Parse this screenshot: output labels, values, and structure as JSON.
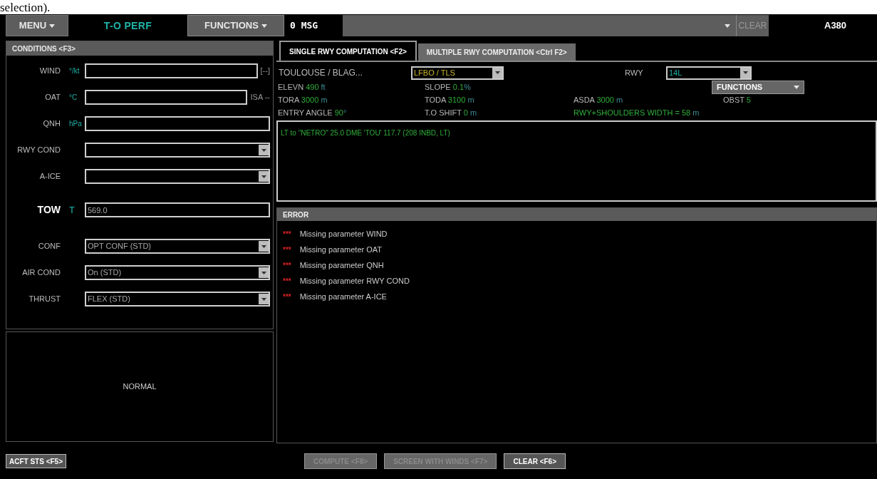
{
  "page_fragment": "selection).",
  "top_bar": {
    "menu": "MENU",
    "app_title": "T-O PERF",
    "functions": "FUNCTIONS",
    "msg_count": "0 MSG",
    "clear": {
      "label": "CLEAR",
      "disabled": true
    },
    "aircraft": "A380"
  },
  "conditions": {
    "title": "CONDITIONS <F3>",
    "groups": [
      [
        {
          "kind": "text",
          "label": "WIND",
          "unit": "°/kt",
          "suffix": "[--]"
        },
        {
          "kind": "text",
          "label": "OAT",
          "unit": "°C",
          "suffix": "ISA --"
        },
        {
          "kind": "text",
          "label": "QNH",
          "unit": "hPa"
        },
        {
          "kind": "select",
          "label": "RWY COND"
        },
        {
          "kind": "select",
          "label": "A-ICE"
        }
      ],
      [
        {
          "kind": "text",
          "label": "TOW",
          "unit": "T",
          "value": "569.0",
          "emphasis": true
        }
      ],
      [
        {
          "kind": "select",
          "label": "CONF",
          "value": "OPT CONF (STD)"
        },
        {
          "kind": "select",
          "label": "AIR COND",
          "value": "On (STD)"
        },
        {
          "kind": "select",
          "label": "THRUST",
          "value": "FLEX (STD)"
        }
      ]
    ]
  },
  "status": {
    "text": "NORMAL"
  },
  "tabs": [
    {
      "label": "SINGLE RWY COMPUTATION <F2>",
      "selected": true
    },
    {
      "label": "MULTIPLE RWY COMPUTATION <Ctrl F2>",
      "selected": false
    }
  ],
  "runway": {
    "airport": "TOULOUSE / BLAG...",
    "airport_code": "LFBO / TLS",
    "rwy_label": "RWY",
    "rwy": "14L",
    "functions": "FUNCTIONS",
    "rows": [
      [
        {
          "label": "ELEVN",
          "value": "490",
          "unit": "ft"
        },
        {
          "label": "SLOPE",
          "value": "0.1",
          "unit": "%"
        }
      ],
      [
        {
          "label": "TORA",
          "value": "3000",
          "unit": "m"
        },
        {
          "label": "TODA",
          "value": "3100",
          "unit": "m"
        },
        {
          "label": "ASDA",
          "value": "3000",
          "unit": "m"
        },
        {
          "label": "OBST",
          "value": "5"
        }
      ],
      [
        {
          "label": "ENTRY ANGLE",
          "value": "90",
          "unit": "°"
        },
        {
          "label": "T.O SHIFT",
          "value": "0",
          "unit": "m"
        },
        {
          "label": "RWY+SHOULDERS WIDTH =",
          "value": "58",
          "unit": "m",
          "kind": "highlight"
        }
      ]
    ],
    "notes": "LT to \"NETRO\" 25.0 DME 'TOU' 117.7 (208 INBD, LT)"
  },
  "errors": {
    "title": "ERROR",
    "items": [
      {
        "marker": "***",
        "text": "Missing parameter WIND"
      },
      {
        "marker": "***",
        "text": "Missing parameter OAT"
      },
      {
        "marker": "***",
        "text": "Missing parameter QNH"
      },
      {
        "marker": "***",
        "text": "Missing parameter RWY COND"
      },
      {
        "marker": "***",
        "text": "Missing parameter A-ICE"
      }
    ]
  },
  "bottom_bar": {
    "acft_sts": "ACFT STS <F5>",
    "actions": [
      {
        "label": "COMPUTE <F8>",
        "disabled": true
      },
      {
        "label": "SCREEN WITH WINDS <F7>",
        "disabled": true
      },
      {
        "label": "CLEAR <F6>",
        "disabled": false
      }
    ]
  }
}
